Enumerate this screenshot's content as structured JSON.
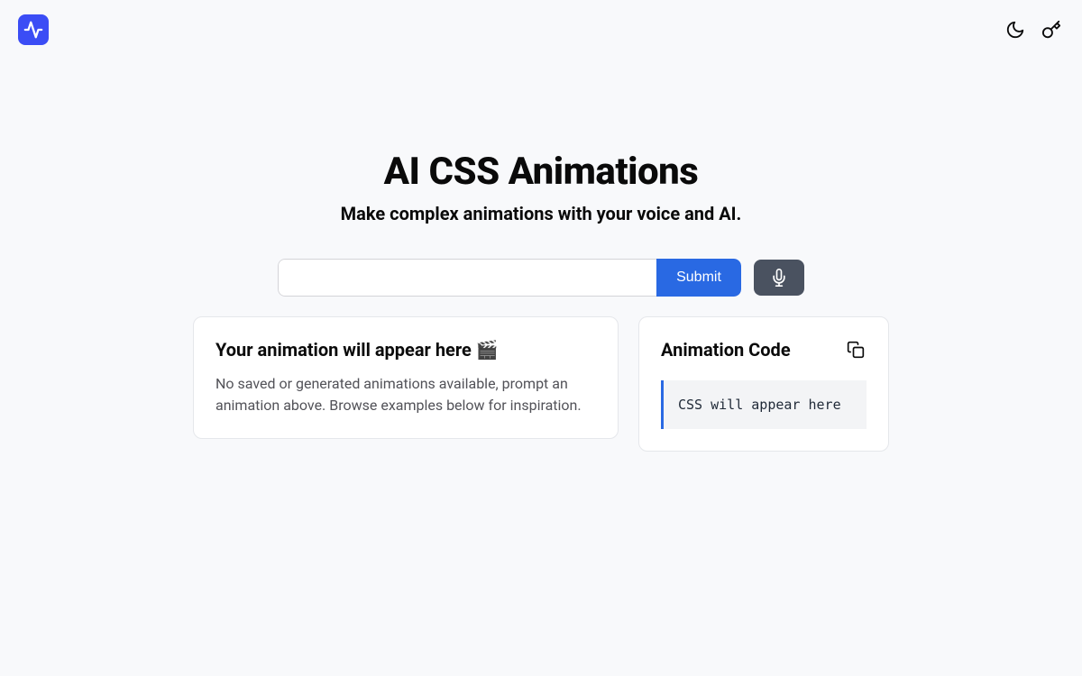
{
  "header": {
    "logo_name": "activity-logo"
  },
  "hero": {
    "title": "AI CSS Animations",
    "subtitle": "Make complex animations with your voice and AI."
  },
  "input": {
    "value": "",
    "submit_label": "Submit"
  },
  "preview_card": {
    "title": "Your animation will appear here 🎬",
    "description": "No saved or generated animations available, prompt an animation above. Browse examples below for inspiration."
  },
  "code_card": {
    "title": "Animation Code",
    "code_placeholder": "CSS will appear here"
  }
}
